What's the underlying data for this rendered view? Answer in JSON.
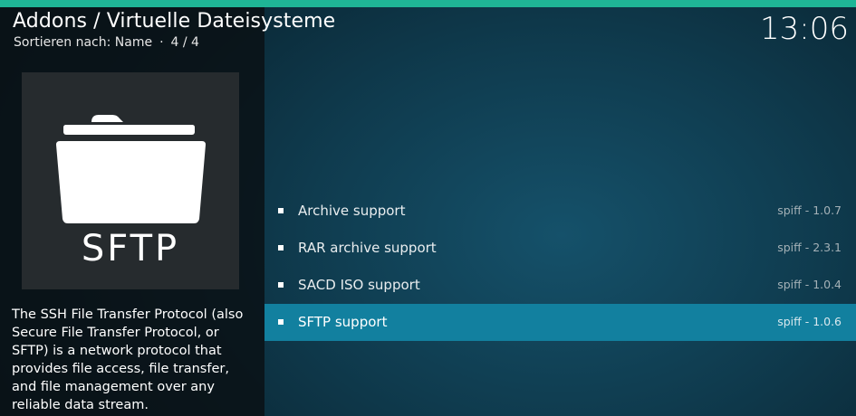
{
  "header": {
    "title": "Addons / Virtuelle Dateisysteme",
    "sort_label": "Sortieren nach: Name",
    "separator": "·",
    "position": "4 / 4",
    "clock": "13:06"
  },
  "colors": {
    "accent_bar": "#1fb596",
    "selected_row": "#12809f"
  },
  "thumbnail": {
    "icon": "folder-icon",
    "text": "SFTP"
  },
  "description": "The SSH File Transfer Protocol (also Secure File Transfer Protocol, or SFTP) is a network protocol that provides file access, file transfer, and file management over any reliable data stream.",
  "list": {
    "items": [
      {
        "label": "Archive support",
        "meta": "spiff - 1.0.7",
        "selected": false
      },
      {
        "label": "RAR archive support",
        "meta": "spiff - 2.3.1",
        "selected": false
      },
      {
        "label": "SACD ISO support",
        "meta": "spiff - 1.0.4",
        "selected": false
      },
      {
        "label": "SFTP support",
        "meta": "spiff - 1.0.6",
        "selected": true
      }
    ]
  }
}
